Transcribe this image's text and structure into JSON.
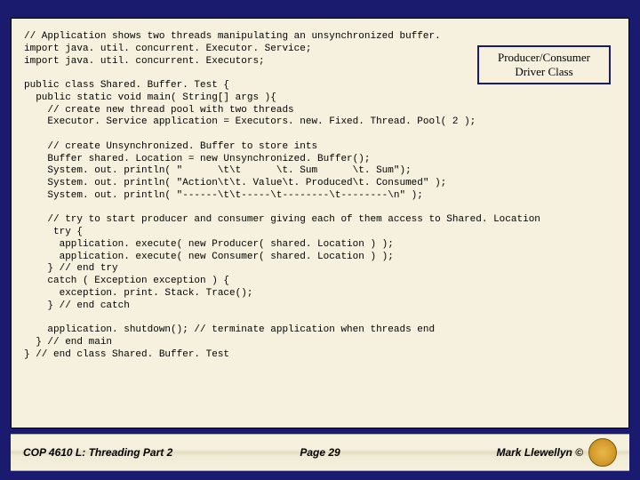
{
  "code": "// Application shows two threads manipulating an unsynchronized buffer.\nimport java. util. concurrent. Executor. Service;\nimport java. util. concurrent. Executors;\n\npublic class Shared. Buffer. Test {\n  public static void main( String[] args ){\n    // create new thread pool with two threads\n    Executor. Service application = Executors. new. Fixed. Thread. Pool( 2 );\n\n    // create Unsynchronized. Buffer to store ints\n    Buffer shared. Location = new Unsynchronized. Buffer();\n    System. out. println( \"      \\t\\t      \\t. Sum      \\t. Sum\");\n    System. out. println( \"Action\\t\\t. Value\\t. Produced\\t. Consumed\" );\n    System. out. println( \"------\\t\\t-----\\t--------\\t--------\\n\" );\n\n    // try to start producer and consumer giving each of them access to Shared. Location\n     try {\n      application. execute( new Producer( shared. Location ) );\n      application. execute( new Consumer( shared. Location ) );\n    } // end try\n    catch ( Exception exception ) {\n      exception. print. Stack. Trace();\n    } // end catch\n\n    application. shutdown(); // terminate application when threads end\n  } // end main\n} // end class Shared. Buffer. Test",
  "callout": {
    "line1": "Producer/Consumer",
    "line2": "Driver Class"
  },
  "footer": {
    "left": "COP 4610 L: Threading Part 2",
    "center": "Page 29",
    "right": "Mark Llewellyn ©"
  }
}
